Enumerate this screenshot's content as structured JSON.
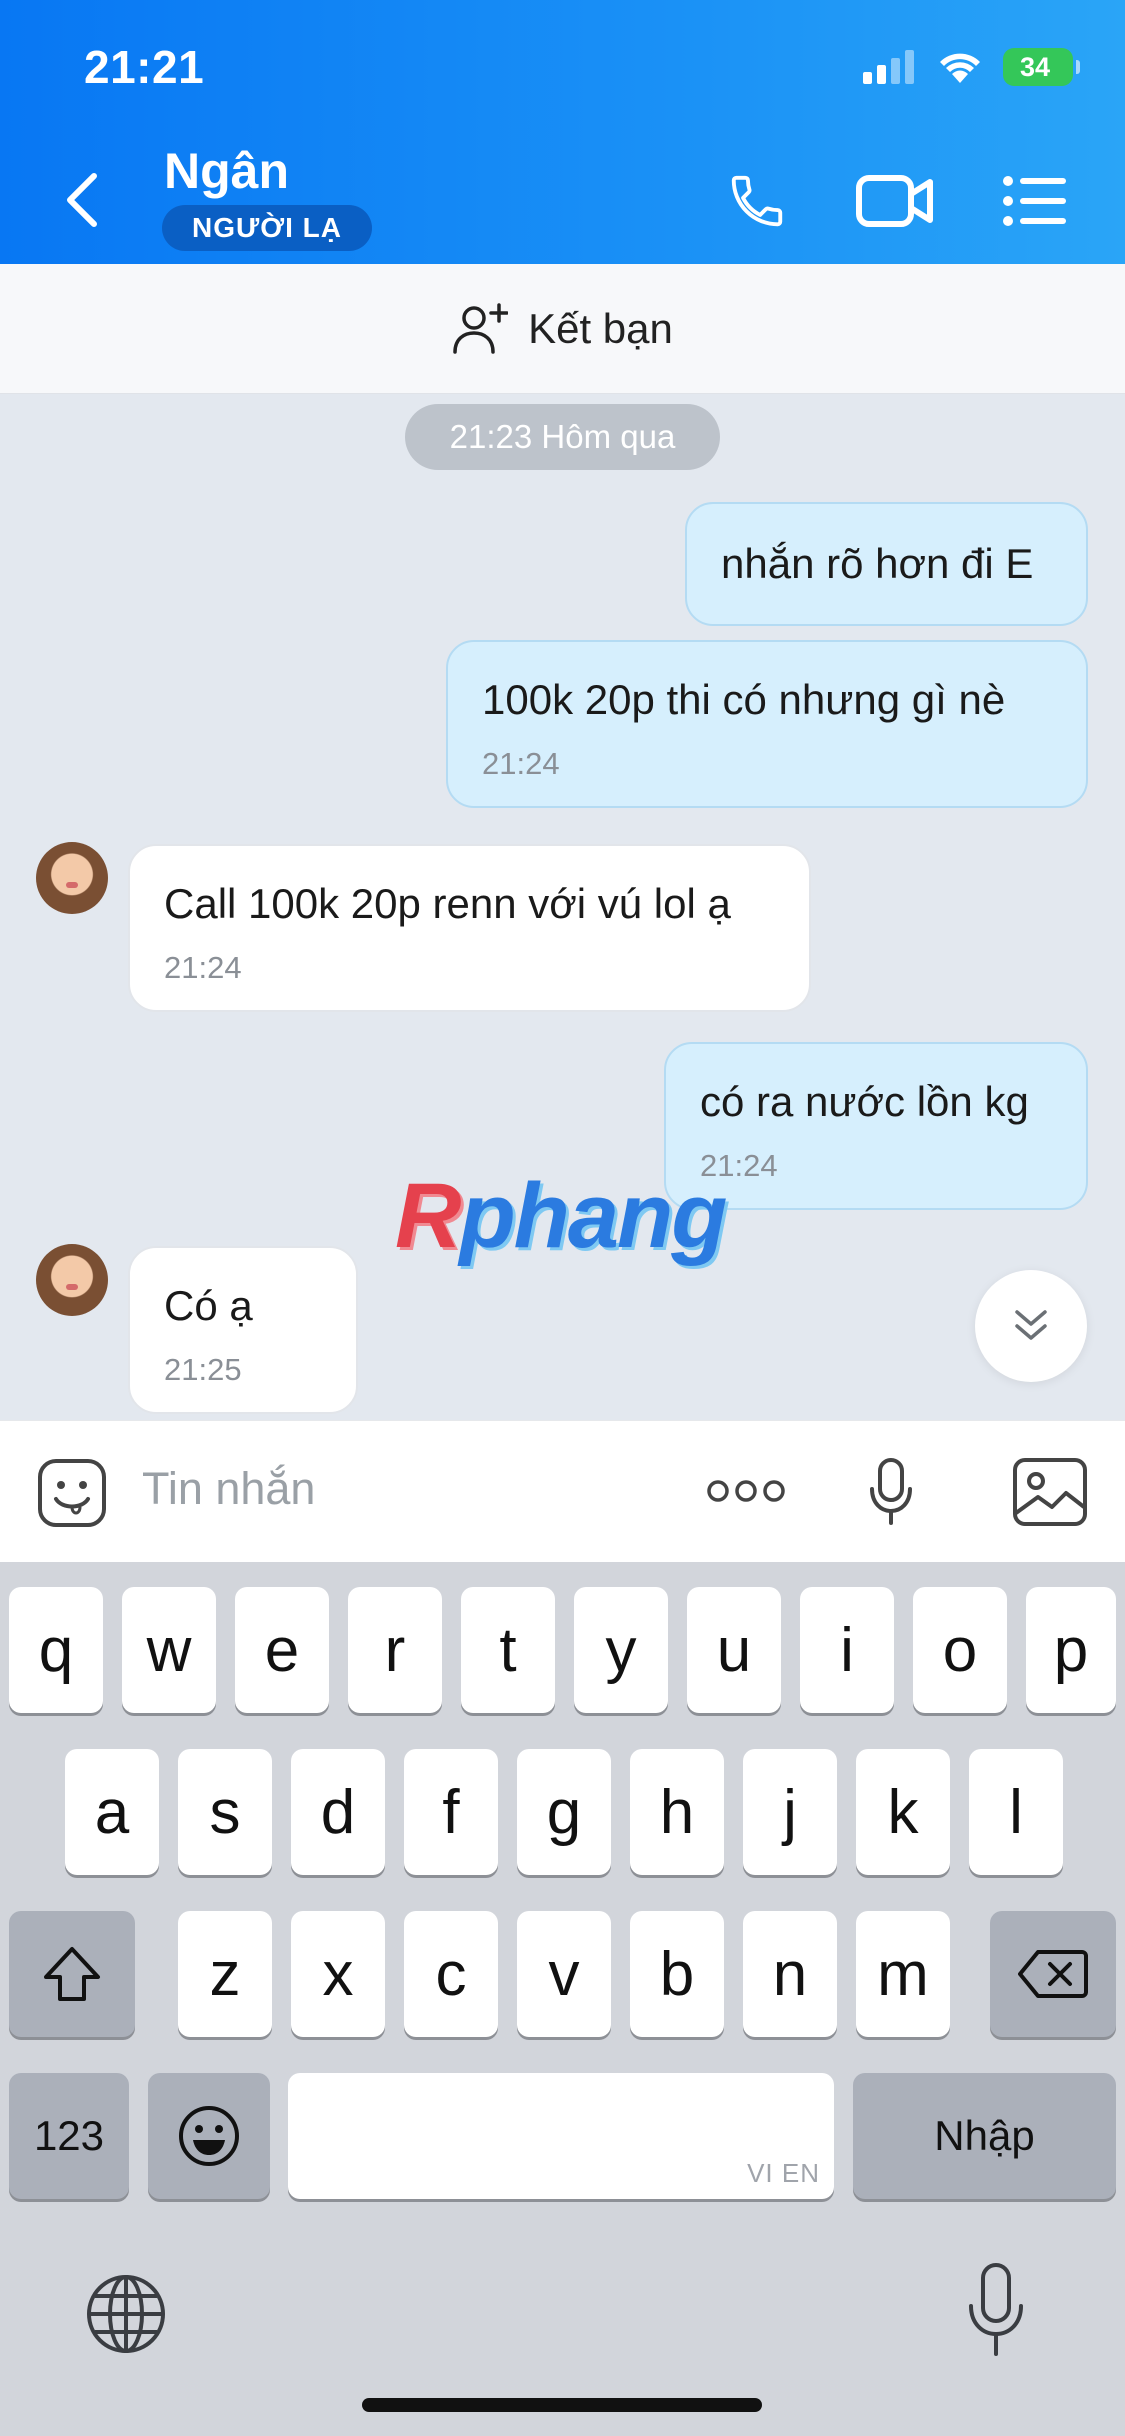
{
  "status_bar": {
    "time": "21:21",
    "battery": "34"
  },
  "header": {
    "contact_name": "Ngân",
    "badge": "NGƯỜI LẠ",
    "icons": [
      "back-chevron-icon",
      "phone-icon",
      "video-call-icon",
      "menu-list-icon"
    ],
    "accent_color": "#0a7cf4"
  },
  "add_friend": {
    "label": "Kết bạn",
    "icon": "add-user-icon"
  },
  "chat": {
    "date_separator": "21:23 Hôm qua",
    "messages": [
      {
        "direction": "outgoing",
        "text": "nhắn rõ hơn đi E",
        "time": ""
      },
      {
        "direction": "outgoing",
        "text": "100k 20p thi có nhưng gì nè",
        "time": "21:24"
      },
      {
        "direction": "incoming",
        "text": "Call 100k 20p renn với vú lol ạ",
        "time": "21:24"
      },
      {
        "direction": "outgoing",
        "text": "có ra nước lồn kg",
        "time": "21:24"
      },
      {
        "direction": "incoming",
        "text": "Có ạ",
        "time": "21:25"
      }
    ],
    "watermark": "Rphang"
  },
  "composer": {
    "placeholder": "Tin nhắn",
    "icons": [
      "sticker-icon",
      "more-icon",
      "microphone-icon",
      "image-icon"
    ]
  },
  "keyboard": {
    "row1": [
      "q",
      "w",
      "e",
      "r",
      "t",
      "y",
      "u",
      "i",
      "o",
      "p"
    ],
    "row2": [
      "a",
      "s",
      "d",
      "f",
      "g",
      "h",
      "j",
      "k",
      "l"
    ],
    "row3": [
      "z",
      "x",
      "c",
      "v",
      "b",
      "n",
      "m"
    ],
    "numbers_key": "123",
    "return_key": "Nhập",
    "space_hint": "VI EN"
  }
}
